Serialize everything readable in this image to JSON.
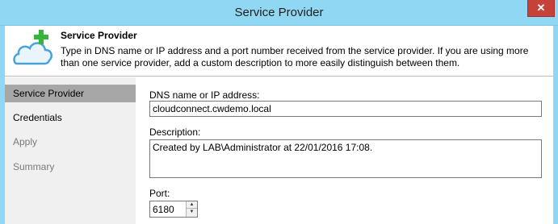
{
  "window": {
    "title": "Service Provider",
    "close_glyph": "✕",
    "title_bar_color": "#8fd7f2",
    "close_button_color": "#c7413b"
  },
  "header": {
    "icon": "cloud-add-icon",
    "title": "Service Provider",
    "description": "Type in DNS name or IP address and a port number received from the service provider. If you are using more than one service provider, add a custom description to more easily distinguish between them."
  },
  "sidebar": {
    "items": [
      {
        "label": "Service Provider",
        "state": "active"
      },
      {
        "label": "Credentials",
        "state": "normal"
      },
      {
        "label": "Apply",
        "state": "disabled"
      },
      {
        "label": "Summary",
        "state": "disabled"
      }
    ]
  },
  "form": {
    "dns_label": "DNS name or IP address:",
    "dns_value": "cloudconnect.cwdemo.local",
    "description_label": "Description:",
    "description_value": "Created by LAB\\Administrator at 22/01/2016 17:08.",
    "port_label": "Port:",
    "port_value": "6180",
    "spin_up_glyph": "▲",
    "spin_down_glyph": "▼"
  }
}
